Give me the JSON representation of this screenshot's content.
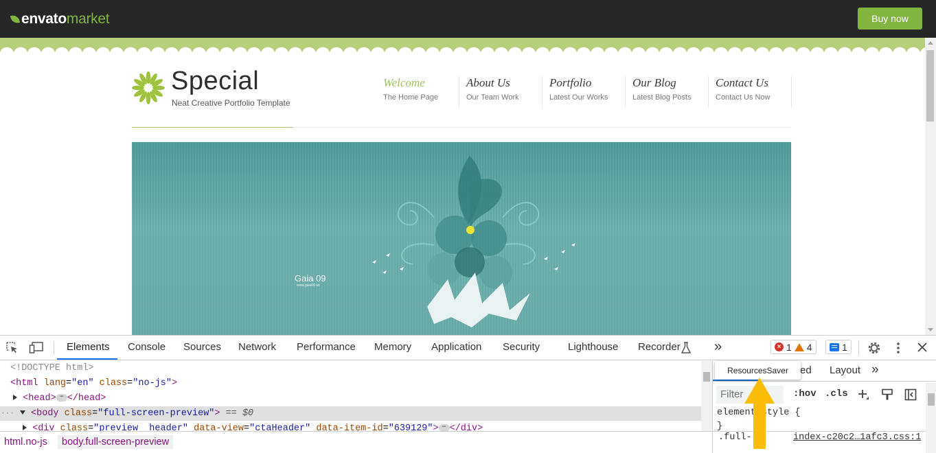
{
  "envato": {
    "logo_word1": "envato",
    "logo_word2": "market",
    "buy_label": "Buy now",
    "brand_color": "#82b540"
  },
  "site": {
    "title": "Special",
    "subtitle": "Neat Creative Portfolio Template",
    "accent_color": "#9fbe5e",
    "nav": [
      {
        "title": "Welcome",
        "sub": "The Home Page"
      },
      {
        "title": "About Us",
        "sub": "Our Team Work"
      },
      {
        "title": "Portfolio",
        "sub": "Latest Our Works"
      },
      {
        "title": "Our Blog",
        "sub": "Latest Blog Posts"
      },
      {
        "title": "Contact Us",
        "sub": "Contact Us Now"
      }
    ],
    "slide": {
      "title": "Gaia 09",
      "url": "www.gaia09.us"
    }
  },
  "devtools": {
    "tabs": [
      "Elements",
      "Console",
      "Sources",
      "Network",
      "Performance",
      "Memory",
      "Application",
      "Security",
      "Lighthouse",
      "Recorder"
    ],
    "active_tab": "Elements",
    "more_tabs_glyph": "»",
    "errors": "1",
    "warnings": "4",
    "messages": "1",
    "dom": {
      "l1": "<!DOCTYPE html>",
      "l2_tag_open": "<html",
      "l2_attr1": "lang",
      "l2_val1": "\"en\"",
      "l2_attr2": "class",
      "l2_val2": "\"no-js\"",
      "l2_tag_close": ">",
      "l3_open": "<head>",
      "l3_close": "</head>",
      "l4_tag_open": "<body",
      "l4_attr": "class",
      "l4_val": "\"full-screen-preview\"",
      "l4_tag_close": ">",
      "l4_suffix": "== $0",
      "l5_tag_open": "<div",
      "l5_attr1": "class",
      "l5_val1": "\"preview__header\"",
      "l5_attr2": "data-view",
      "l5_val2": "\"ctaHeader\"",
      "l5_attr3": "data-item-id",
      "l5_val3": "\"639129\"",
      "l5_tag_close": ">",
      "l5_end": "</div>",
      "ellipsis": "⋯"
    },
    "breadcrumbs": [
      "html.no-js",
      "body.full-screen-preview"
    ],
    "styles": {
      "tab_partial": "ed",
      "tab_layout": "Layout",
      "more_glyph": "»",
      "filter_placeholder": "Filter",
      "hov": ":hov",
      "cls": ".cls",
      "element_style_open": "element.style {",
      "element_style_close": "}",
      "rule_selector": ".full-",
      "rule_source": "index-c20c2…1afc3.css:1"
    },
    "tooltip": "ResourcesSaver",
    "arrow_color": "#fbbd08"
  }
}
